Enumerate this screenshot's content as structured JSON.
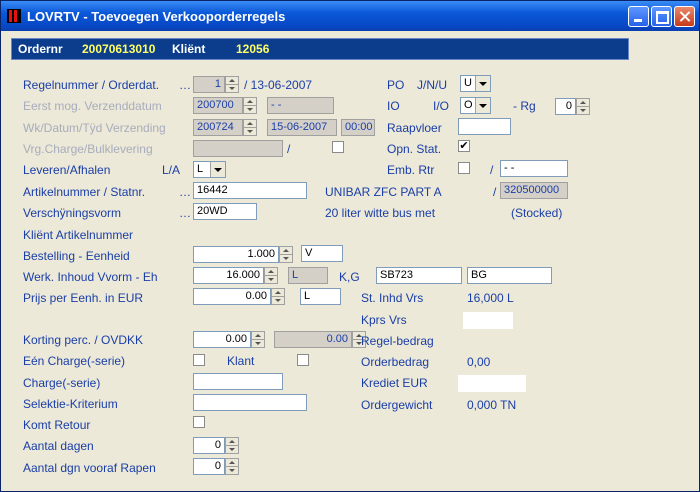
{
  "window": {
    "title": "LOVRTV - Toevoegen Verkooporderregels"
  },
  "header": {
    "ordernr_label": "Ordernr",
    "ordernr_value": "20070613010",
    "klient_label": "Kliënt",
    "klient_value": "12056"
  },
  "colors": {
    "title_bar": "#0747c4",
    "header_bg": "#0b3d8c",
    "header_value": "#ffff66",
    "label": "#1a3ea8",
    "disabled_label": "#a8acbc"
  },
  "fields": {
    "regelnummer_label": "Regelnummer / Orderdat.",
    "regelnummer_value": "1",
    "orderdatum": "/ 13-06-2007",
    "eerst_label": "Eerst mog. Verzenddatum",
    "eerst_value": "200700",
    "eerst_date": "- -",
    "wk_label": "Wk/Datum/Tÿd Verzending",
    "wk_value": "200724",
    "wk_date": "15-06-2007",
    "wk_time": "00:00",
    "vrg_label": "Vrg.Charge/Bulklevering",
    "vrg_slash": "/",
    "leveren_label": "Leveren/Afhalen",
    "leveren_code": "L/A",
    "leveren_value": "L",
    "artikel_label": "Artikelnummer / Statnr.",
    "artikel_value": "16442",
    "artikel_desc": "UNIBAR ZFC PART A",
    "statnr": "320500000",
    "statnr_slash": "/",
    "verschijning_label": "Verschÿningsvorm",
    "verschijning_value": "20WD",
    "verschijning_desc": "20 liter witte bus met",
    "stocked": "(Stocked)",
    "klient_artikelnummer_label": "Kliënt Artikelnummer",
    "bestelling_label": "Bestelling - Eenheid",
    "bestelling_value": "1.000",
    "bestelling_unit": "V",
    "werk_label": "Werk. Inhoud Vvorm - Eh",
    "werk_value": "16.000",
    "werk_unit": "L",
    "kg_label": "K,G",
    "kg_code1": "SB723",
    "kg_code2": "BG",
    "prijs_label": "Prijs per Eenh. in EUR",
    "prijs_value": "0.00",
    "prijs_unit": "L",
    "st_inhd_label": "St. Inhd Vrs",
    "st_inhd_value": "16,000 L",
    "kprs_label": "Kprs Vrs",
    "korting_label": "Korting perc. / OVDKK",
    "korting_value": "0.00",
    "ovdkk_value": "0.00",
    "regel_bedrag_label": "Regel-bedrag",
    "een_charge_label": "Eén Charge(-serie)",
    "klant_label": "Klant",
    "orderbedrag_label": "Orderbedrag",
    "orderbedrag_value": "0,00",
    "charge_serie_label": "Charge(-serie)",
    "krediet_label": "Krediet EUR",
    "selektie_label": "Selektie-Kriterium",
    "ordergewicht_label": "Ordergewicht",
    "ordergewicht_value": "0,000 TN",
    "komt_retour_label": "Komt Retour",
    "aantal_dagen_label": "Aantal dagen",
    "aantal_dagen_value": "0",
    "aantal_dgn_label": "Aantal dgn vooraf Rapen",
    "aantal_dgn_value": "0"
  },
  "right": {
    "po_label": "PO",
    "po_jnu": "J/N/U",
    "po_value": "U",
    "io_label": "IO",
    "io_io": "I/O",
    "io_value": "O",
    "rg_label": "- Rg",
    "rg_value": "0",
    "raapvloer_label": "Raapvloer",
    "opn_stat_label": "Opn. Stat.",
    "opn_stat_checked": "✔",
    "emb_rtr_label": "Emb. Rtr",
    "emb_slash": "/",
    "emb_value": "- -"
  }
}
